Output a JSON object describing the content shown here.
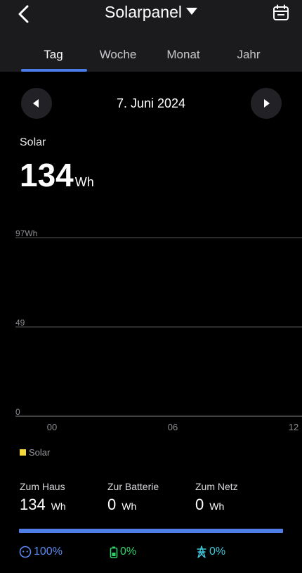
{
  "header": {
    "title": "Solarpanel"
  },
  "tabs": [
    {
      "label": "Tag",
      "active": true
    },
    {
      "label": "Woche",
      "active": false
    },
    {
      "label": "Monat",
      "active": false
    },
    {
      "label": "Jahr",
      "active": false
    }
  ],
  "date": "7. Juni 2024",
  "summary": {
    "label": "Solar",
    "value": "134",
    "unit": "Wh"
  },
  "chart_data": {
    "type": "bar",
    "y_tick_labels": [
      "97Wh",
      "49",
      "0"
    ],
    "x_tick_labels": [
      "00",
      "06",
      "12"
    ],
    "ylim": [
      0,
      97
    ],
    "series": [
      {
        "name": "Solar",
        "color": "#f6d73a",
        "values": []
      }
    ],
    "grid": true
  },
  "stats": [
    {
      "label": "Zum Haus",
      "value": "134",
      "unit": "Wh"
    },
    {
      "label": "Zur Batterie",
      "value": "0",
      "unit": "Wh"
    },
    {
      "label": "Zum Netz",
      "value": "0",
      "unit": "Wh"
    }
  ],
  "distribution": [
    {
      "icon": "home-smile-icon",
      "text": "100%",
      "color": "#5b8af0"
    },
    {
      "icon": "battery-icon",
      "text": "0%",
      "color": "#2fd36a"
    },
    {
      "icon": "grid-tower-icon",
      "text": "0%",
      "color": "#3fc6d8"
    }
  ],
  "colors": {
    "accent": "#4a7ae6",
    "bar": "#4f7ee8",
    "legend_solar": "#f6d73a"
  }
}
